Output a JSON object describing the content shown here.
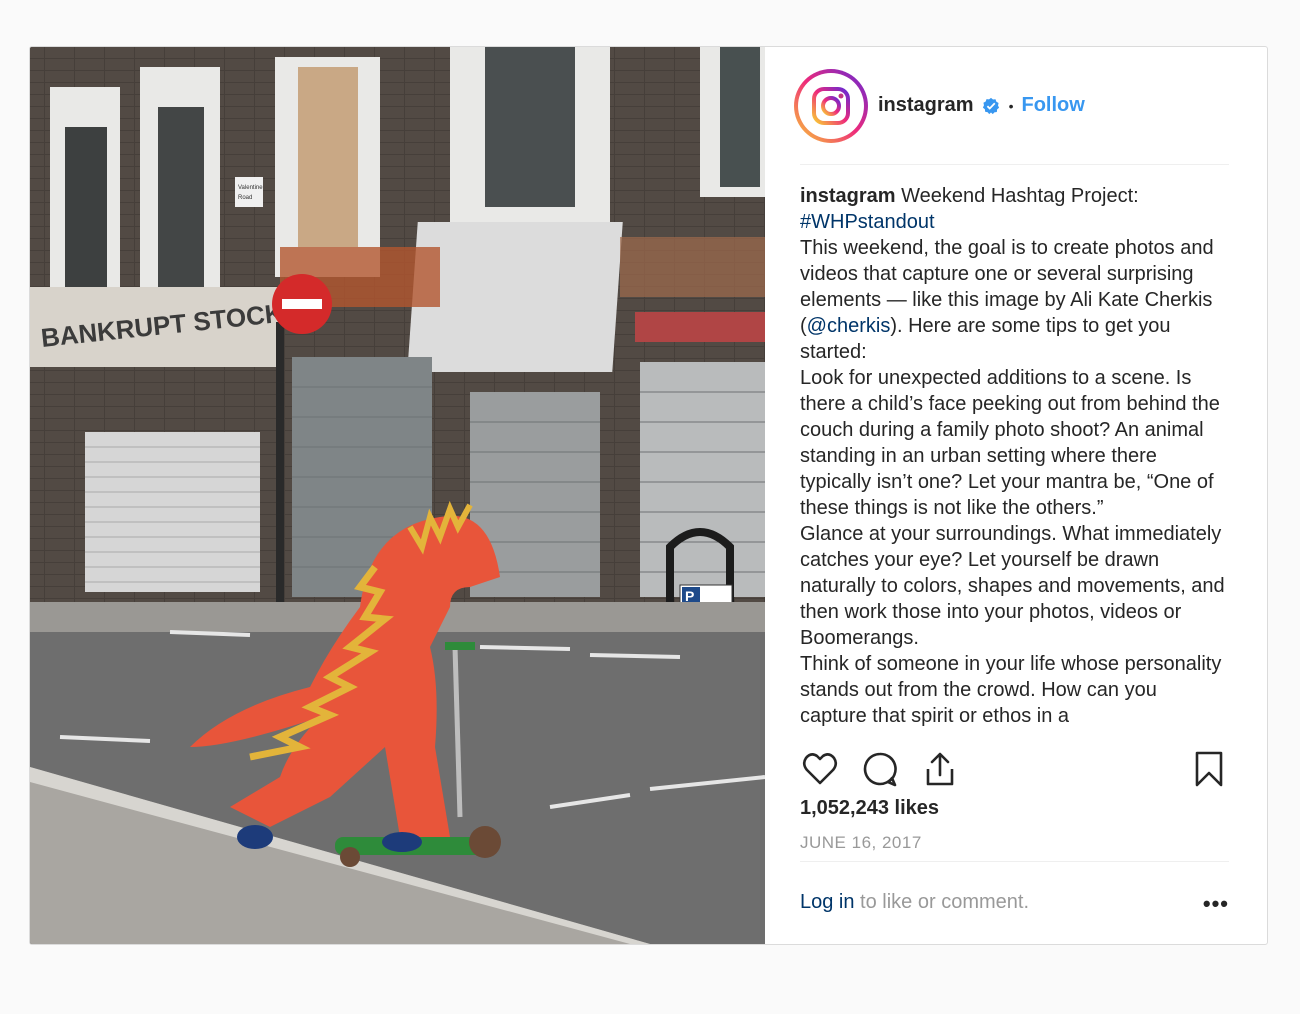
{
  "post": {
    "username": "instagram",
    "follow_label": "Follow",
    "separator": "•",
    "caption": {
      "lead_text": "Weekend Hashtag Project:",
      "hashtag": "#WHPstandout",
      "p1_a": "This weekend, the goal is to create photos and videos that capture one or several surprising elements — like this image by Ali Kate Cherkis (",
      "mention": "@cherkis",
      "p1_b": "). Here are some tips to get you started:",
      "p2": "Look for unexpected additions to a scene. Is there a child’s face peeking out from behind the couch during a family photo shoot? An animal standing in an urban setting where there typically isn’t one? Let your mantra be, “One of these things is not like the others.”",
      "p3": "Glance at your surroundings. What immediately catches your eye? Let yourself be drawn naturally to colors, shapes and movements, and then work those into your photos, videos or Boomerangs.",
      "p4": "Think of someone in your life whose personality stands out from the crowd. How can you capture that spirit or ethos in a"
    },
    "likes": "1,052,243 likes",
    "date": "JUNE 16, 2017",
    "login_link": "Log in",
    "login_rest": " to like or comment.",
    "more": "•••",
    "photo": {
      "shop_sign": "BANKRUPT STOCK.",
      "street_sign_1": "Valentine",
      "street_sign_2": "Road",
      "parking_sign": "P",
      "colors": {
        "costume": "#e8553a",
        "spikes": "#e3b43a",
        "scooter": "#2e8b3a",
        "road": "#6e6e6e",
        "brick": "#4d4640"
      }
    },
    "icons": [
      "verified-badge-icon",
      "heart-icon",
      "comment-icon",
      "share-icon",
      "bookmark-icon"
    ],
    "accent_color": "#3897f0",
    "link_color": "#003569"
  }
}
